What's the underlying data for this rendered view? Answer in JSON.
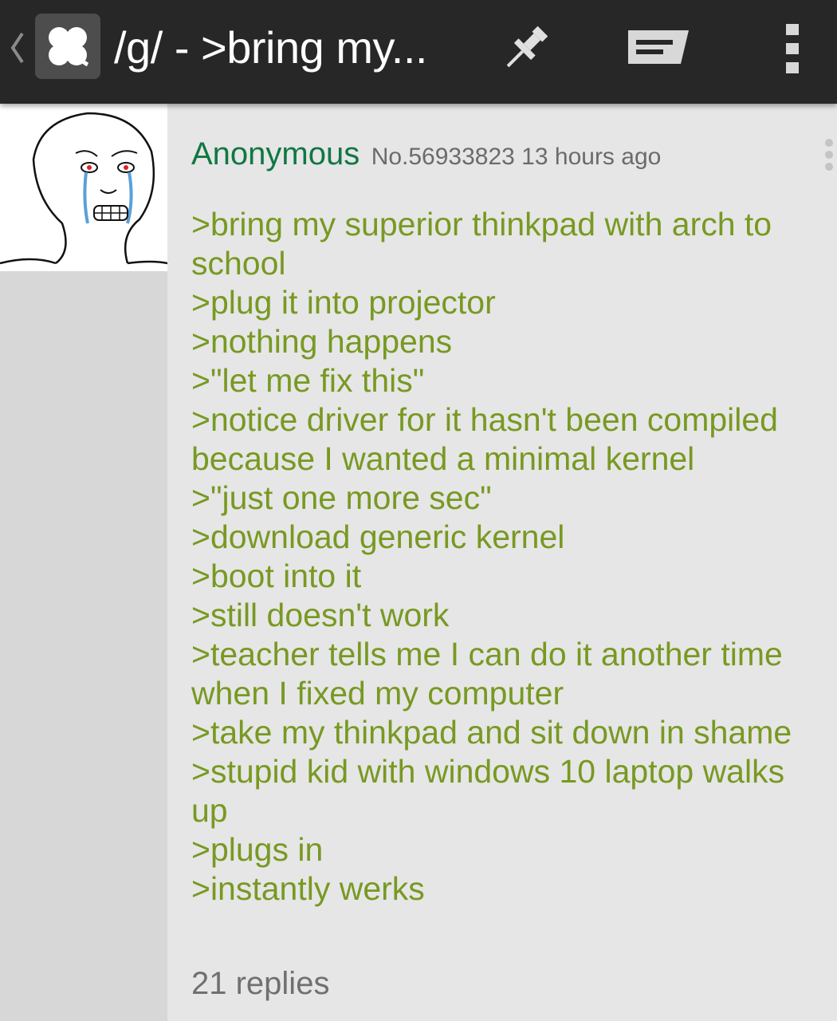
{
  "appbar": {
    "title": "/g/ - >bring my...",
    "icons": {
      "back": "chevron-left-icon",
      "logo": "clover-icon",
      "pin": "pushpin-icon",
      "reply": "reply-icon",
      "menu": "more-vertical-icon"
    }
  },
  "post": {
    "name": "Anonymous",
    "meta": "No.56933823 13 hours ago",
    "thumbnail": "crying-wojak-image",
    "lines": [
      ">bring my superior thinkpad with arch to",
      "school",
      ">plug it into projector",
      ">nothing happens",
      ">\"let me fix this\"",
      ">notice driver for it hasn't been compiled",
      "because I wanted a minimal kernel",
      ">\"just one more sec\"",
      ">download generic kernel",
      ">boot into it",
      ">still doesn't work",
      ">teacher tells me I can do it another time",
      "when I fixed my computer",
      ">take my thinkpad and sit down in shame",
      ">stupid kid with windows 10 laptop walks",
      "up",
      ">plugs in",
      ">instantly werks"
    ],
    "replies": "21 replies"
  },
  "colors": {
    "appbar": "#272727",
    "greentext": "#789922",
    "name": "#117743",
    "meta": "#6b6b6b",
    "background": "#e6e6e6",
    "sidebar": "#d7d7d7"
  }
}
